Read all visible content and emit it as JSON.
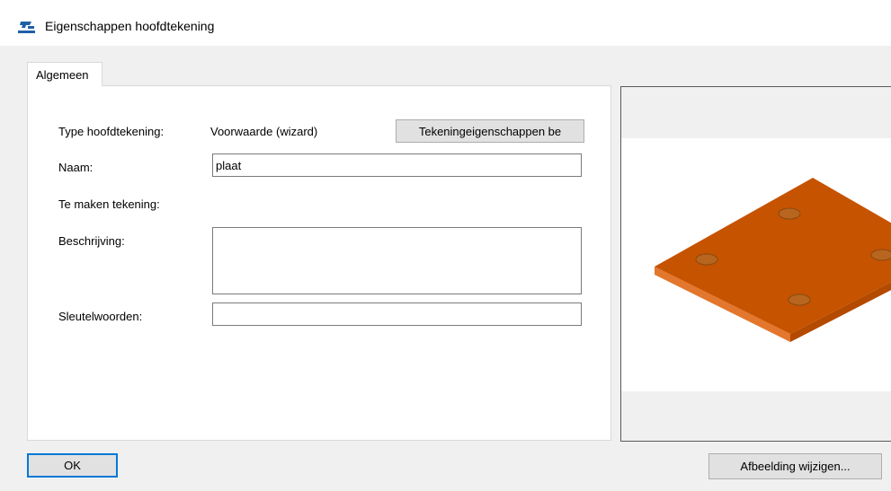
{
  "window": {
    "title": "Eigenschappen hoofdtekening",
    "icon": "drawing-app-icon"
  },
  "tabs": [
    {
      "label": "Algemeen",
      "active": true
    }
  ],
  "form": {
    "type_label": "Type hoofdtekening:",
    "type_value": "Voorwaarde (wizard)",
    "drawing_props_button": "Tekeningeigenschappen be",
    "name_label": "Naam:",
    "name_value": "plaat",
    "drawing_to_make_label": "Te maken tekening:",
    "description_label": "Beschrijving:",
    "description_value": "",
    "keywords_label": "Sleutelwoorden:",
    "keywords_value": ""
  },
  "buttons": {
    "ok": "OK",
    "change_image": "Afbeelding wijzigen..."
  },
  "preview": {
    "object": "steel-plate-with-holes",
    "colors": {
      "top": "#c65300",
      "front": "#e2772d",
      "right": "#b34a00",
      "hole": "#b8661f",
      "hole_rim": "#8a4a10"
    }
  }
}
